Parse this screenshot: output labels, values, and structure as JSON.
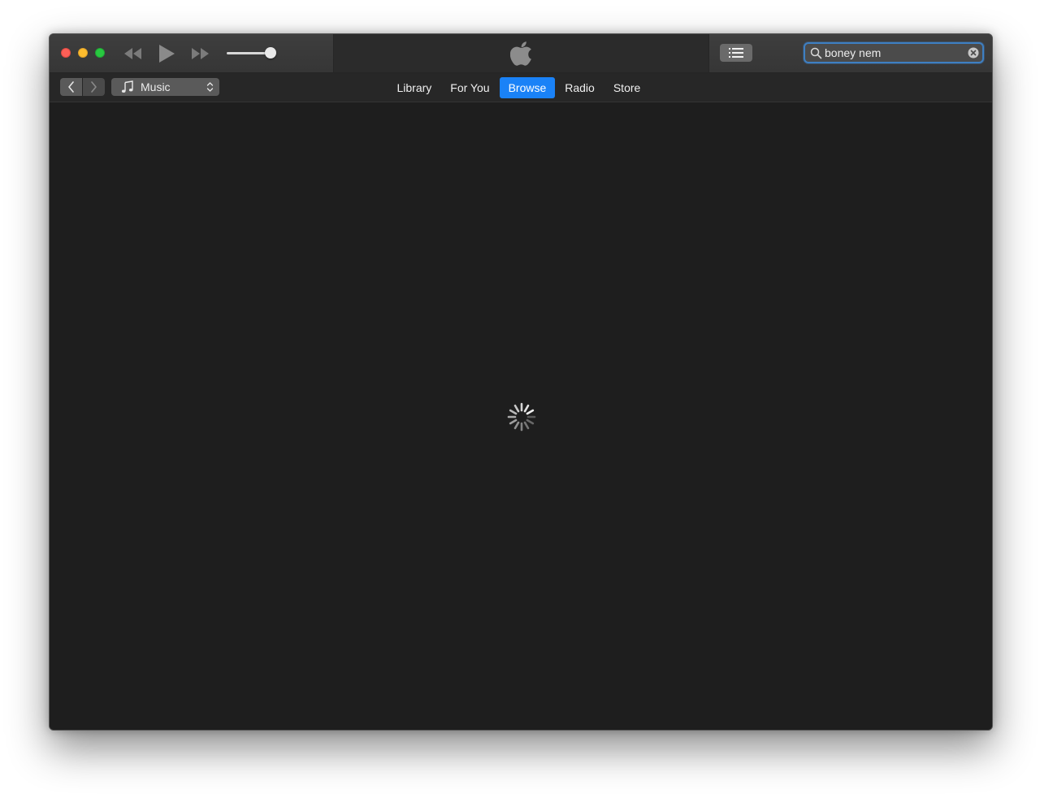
{
  "window": {
    "traffic_lights": [
      "close",
      "minimize",
      "zoom"
    ],
    "colors": {
      "close": "#fc5f57",
      "minimize": "#fdbc2e",
      "zoom": "#28c840",
      "accent": "#1a82f7",
      "background": "#1e1e1e"
    }
  },
  "player": {
    "controls": [
      "rewind-icon",
      "play-icon",
      "fast-forward-icon"
    ],
    "volume_level": 0.9,
    "lcd_icon": "apple-logo-icon"
  },
  "toolbar": {
    "list_button_icon": "list-icon"
  },
  "search": {
    "value": "boney nem",
    "icon": "search-icon",
    "clear_icon": "clear-icon"
  },
  "navigation": {
    "back_icon": "chevron-left-icon",
    "forward_icon": "chevron-right-icon",
    "media_kind": {
      "label": "Music",
      "icon": "music-note-icon"
    },
    "tabs": [
      {
        "label": "Library",
        "active": false
      },
      {
        "label": "For You",
        "active": false
      },
      {
        "label": "Browse",
        "active": true
      },
      {
        "label": "Radio",
        "active": false
      },
      {
        "label": "Store",
        "active": false
      }
    ]
  },
  "content": {
    "state": "loading",
    "icon": "loading-spinner-icon"
  }
}
